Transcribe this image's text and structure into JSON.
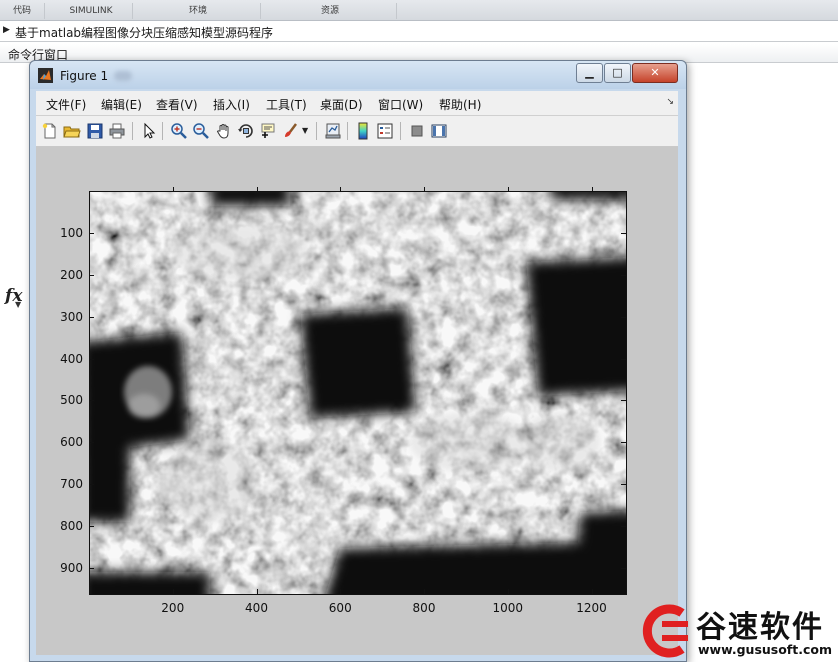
{
  "ribbon": {
    "tabs": [
      "代码",
      "SIMULINK",
      "环境",
      "资源"
    ]
  },
  "path_bar": {
    "text": "基于matlab编程图像分块压缩感知模型源码程序"
  },
  "command_window": {
    "header": "命令行窗口",
    "prompt": "fx"
  },
  "figure": {
    "title": "Figure 1",
    "caption_buttons": {
      "minimize": "▁",
      "maximize": "□",
      "close": "✕"
    },
    "menus": [
      "文件(F)",
      "编辑(E)",
      "查看(V)",
      "插入(I)",
      "工具(T)",
      "桌面(D)",
      "窗口(W)",
      "帮助(H)"
    ],
    "menu_overflow": "↘",
    "toolbar_icons": [
      "new-figure-icon",
      "open-file-icon",
      "save-icon",
      "print-icon",
      "edit-plot-arrow-icon",
      "zoom-in-icon",
      "zoom-out-icon",
      "pan-hand-icon",
      "rotate-3d-icon",
      "data-cursor-icon",
      "brush-icon",
      "brush-dropdown-icon",
      "link-plot-icon",
      "colorbar-icon",
      "legend-icon",
      "hide-plot-tools-icon",
      "show-plot-tools-icon"
    ],
    "axes": {
      "y_ticks": [
        "100",
        "200",
        "300",
        "400",
        "500",
        "600",
        "700",
        "800",
        "900"
      ],
      "x_ticks": [
        "200",
        "400",
        "600",
        "800",
        "1000",
        "1200"
      ],
      "x_range": [
        0,
        1280
      ],
      "y_range": [
        0,
        960
      ],
      "image": "grayscale-micrograph"
    }
  },
  "watermark": {
    "text": "谷速软件",
    "url": "www.gususoft.com",
    "accent_color": "#e02020"
  }
}
